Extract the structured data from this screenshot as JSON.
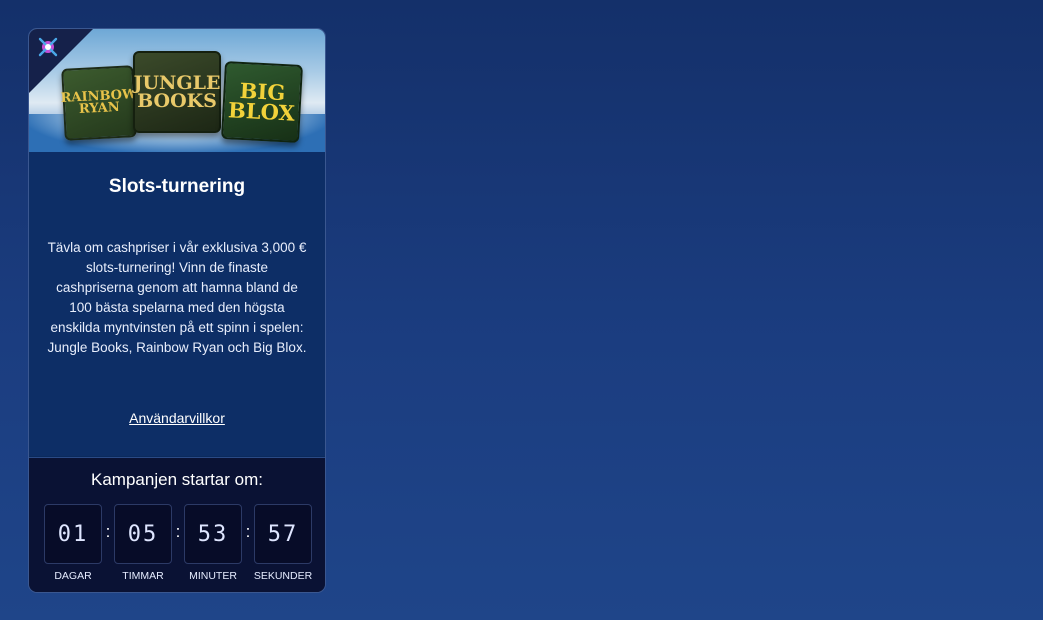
{
  "banner": {
    "games": [
      {
        "name": "RAINBOW RYAN"
      },
      {
        "name": "JUNGLE BOOKS"
      },
      {
        "name": "BIG BLOX"
      }
    ]
  },
  "promo": {
    "title": "Slots-turnering",
    "description": "Tävla om cashpriser i vår exklusiva 3,000 € slots-turnering! Vinn de finaste cashpriserna genom att hamna bland de 100 bästa spelarna med den högsta enskilda myntvinsten på ett spinn i spelen: Jungle Books, Rainbow Ryan och Big Blox.",
    "terms_link": "Användarvillkor"
  },
  "countdown": {
    "heading": "Kampanjen startar om:",
    "separator": ":",
    "units": [
      {
        "value": "01",
        "label": "DAGAR"
      },
      {
        "value": "05",
        "label": "TIMMAR"
      },
      {
        "value": "53",
        "label": "MINUTER"
      },
      {
        "value": "57",
        "label": "SEKUNDER"
      }
    ]
  },
  "colors": {
    "background": "#1b3d80",
    "card_body": "#0d2e66",
    "countdown_panel": "#0a1234",
    "text": "#ffffff"
  }
}
